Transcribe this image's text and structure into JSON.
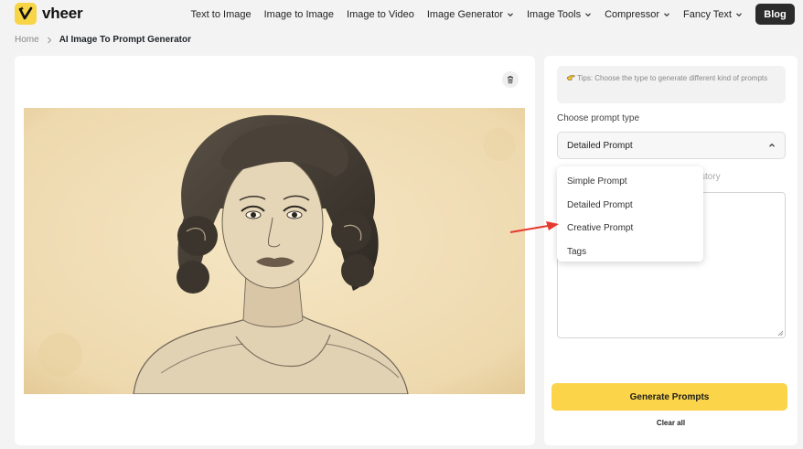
{
  "brand": {
    "name": "vheer",
    "accent_color": "#f7d547"
  },
  "nav": {
    "items": [
      {
        "label": "Text to Image",
        "has_dropdown": false
      },
      {
        "label": "Image to Image",
        "has_dropdown": false
      },
      {
        "label": "Image to Video",
        "has_dropdown": false
      },
      {
        "label": "Image Generator",
        "has_dropdown": true
      },
      {
        "label": "Image Tools",
        "has_dropdown": true
      },
      {
        "label": "Compressor",
        "has_dropdown": true
      },
      {
        "label": "Fancy Text",
        "has_dropdown": true
      }
    ],
    "blog_label": "Blog"
  },
  "breadcrumb": {
    "home": "Home",
    "current": "AI Image To Prompt Generator"
  },
  "left_panel": {
    "trash_icon": "trash-icon",
    "image_description": "pencil sketch portrait"
  },
  "right_panel": {
    "tips": "Tips: Choose the type to generate different kind of prompts",
    "choose_label": "Choose prompt type",
    "selected_type": "Detailed Prompt",
    "history_tab_partial": "story",
    "dropdown_options": [
      "Simple Prompt",
      "Detailed Prompt",
      "Creative Prompt",
      "Tags"
    ],
    "generate_label": "Generate Prompts",
    "clear_label": "Clear all",
    "generate_color": "#fbd44a"
  },
  "annotation": {
    "arrow_color": "#e53a2f",
    "points_to": "Creative Prompt"
  }
}
